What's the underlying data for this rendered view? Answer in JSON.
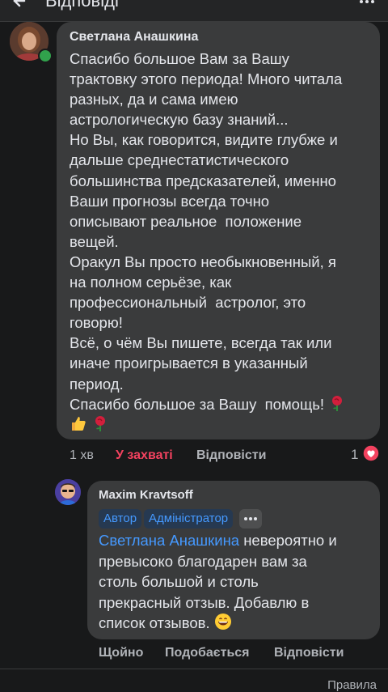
{
  "header": {
    "title": "Відповіді",
    "back_icon": "arrow-left-icon",
    "more_icon": "more-icon"
  },
  "comment": {
    "author": "Светлана Анашкина",
    "online": true,
    "lines": [
      "Спасибо большое Вам за Вашу",
      "трактовку этого периода! Много читала",
      "разных, да и сама имею",
      "астрологическую базу знаний...",
      "Но Вы, как говорится, видите глубже и",
      "дальше среднестатистического",
      "большинства предсказателей, именно",
      "Ваши прогнозы всегда точно",
      "описывают реальное  положение",
      "вещей.",
      "Оракул Вы просто необыкновенный, я",
      "на полном серьёзе, как",
      "профессиональный  астролог, это",
      "говорю!",
      "Всё, о чём Вы пишете, всегда так или",
      "иначе проигрывается в указанный",
      "период.",
      "Спасибо большое за Вашу  помощь!"
    ],
    "end_emojis": [
      "rose",
      "thumbs-up",
      "rose"
    ],
    "time": "1 хв",
    "like_label": "У захваті",
    "reply_label": "Відповісти",
    "reaction_count": "1",
    "reaction_icon": "love-reaction-icon"
  },
  "reply": {
    "author": "Maxim Kravtsoff",
    "badges": [
      "Автор",
      "Адміністратор"
    ],
    "mention": "Светлана Анашкина",
    "lines": [
      " невероятно и",
      "превысоко благодарен вам за",
      "столь большой и столь",
      "прекрасный отзыв. Добавлю в",
      "список отзывов. "
    ],
    "emoji": "grinning-face",
    "time": "Щойно",
    "like_label": "Подобається",
    "reply_label": "Відповісти"
  },
  "footer": {
    "rules_label": "Правила"
  },
  "colors": {
    "background": "#18191a",
    "bubble": "#3a3b3c",
    "love_reaction": "#f3425f",
    "mention": "#4599ff",
    "online": "#31a24c"
  }
}
